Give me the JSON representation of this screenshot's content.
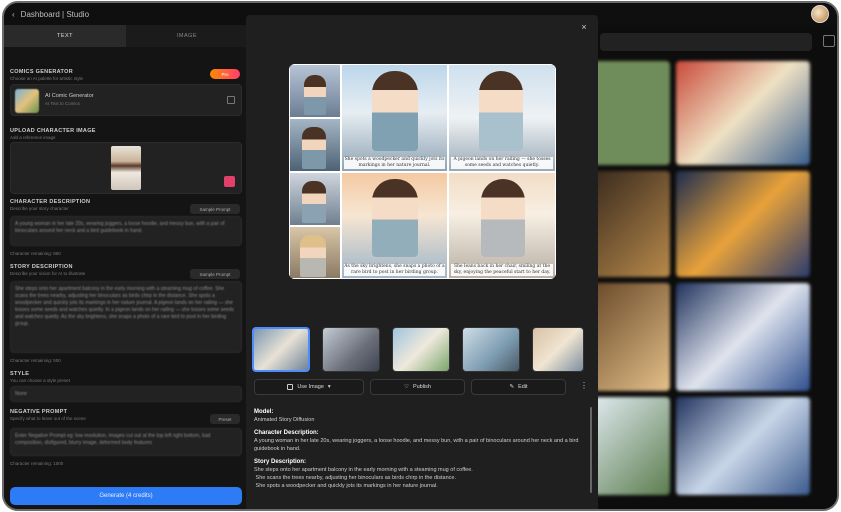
{
  "window": {
    "title": "Dashboard | Studio"
  },
  "left": {
    "tabs": [
      "TEXT",
      "IMAGE"
    ],
    "generator": {
      "label": "COMICS GENERATOR",
      "sub": "Choose an AI palette for artistic style",
      "badge": "Pro",
      "card_title": "AI Comic Generator",
      "card_sub": "AI Text to Comics"
    },
    "upload": {
      "label": "UPLOAD CHARACTER IMAGE",
      "sub": "Add a reference image"
    },
    "character": {
      "label": "CHARACTER DESCRIPTION",
      "sub": "Describe your story character",
      "sample": "Sample Prompt",
      "text": "A young woman in her late 20s, wearing joggers, a loose hoodie, and messy bun, with a pair of binoculars around her neck and a bird guidebook in hand.",
      "remaining": "Character remaining: 860"
    },
    "story": {
      "label": "STORY DESCRIPTION",
      "sub": "Describe your vision for AI to illustrate",
      "sample": "Sample Prompt",
      "text": "She steps onto her apartment balcony in the early morning with a steaming mug of coffee. She scans the trees nearby, adjusting her binoculars as birds chirp in the distance. She spots a woodpecker and quickly jots its markings in her nature journal. A pigeon lands on her railing — she tosses some seeds and watches quietly. In a pigeon lands on her railing — she tosses some seeds and watches quietly. As the sky brightens, she snaps a photo of a rare bird to post in her birding group.",
      "remaining": "Character remaining: 500"
    },
    "style": {
      "label": "STYLE",
      "sub": "You can choose a style preset",
      "value": "None"
    },
    "negative": {
      "label": "NEGATIVE PROMPT",
      "sub": "Specify what to leave out of the scene",
      "preset": "Preset",
      "text": "Enter Negative Prompt eg: low resolution, images cut out at the top left right bottom, bad composition, disfigured, blurry image, deformed body features",
      "remaining": "Character remaining: 1000"
    },
    "generate": "Generate (4 credits)"
  },
  "modal": {
    "close": "×",
    "captions": [
      "She spots a woodpecker and quickly jots its markings in her nature journal.",
      "A pigeon lands on her railing — she tosses some seeds and watches quietly.",
      "As the sky brightens, she snaps a photo of a rare bird to post in her birding group.",
      "She leans back in her chair, smiling at the sky, enjoying the peaceful start to her day."
    ],
    "actions": {
      "use_image": "Use Image",
      "publish": "Publish",
      "edit": "Edit"
    },
    "model_label": "Model:",
    "model_value": "Animated Story Diffusion",
    "char_label": "Character Description:",
    "char_value": "A young woman in her late 20s, wearing joggers, a loose hoodie, and messy bun, with a pair of binoculars around her neck and a bird guidebook in hand.",
    "story_label": "Story Description:",
    "story_lines": [
      "She steps onto her apartment balcony in the early morning with a steaming mug of coffee.",
      " She scans the trees nearby, adjusting her binoculars as birds chirp in the distance.",
      " She spots a woodpecker and quickly jots its markings in her nature journal."
    ]
  },
  "colors": {
    "accent": "#2e7bf6",
    "selected_thumb": "#4d8cff",
    "modal_bg": "#1f1f1f",
    "page_bg": "#121212"
  }
}
